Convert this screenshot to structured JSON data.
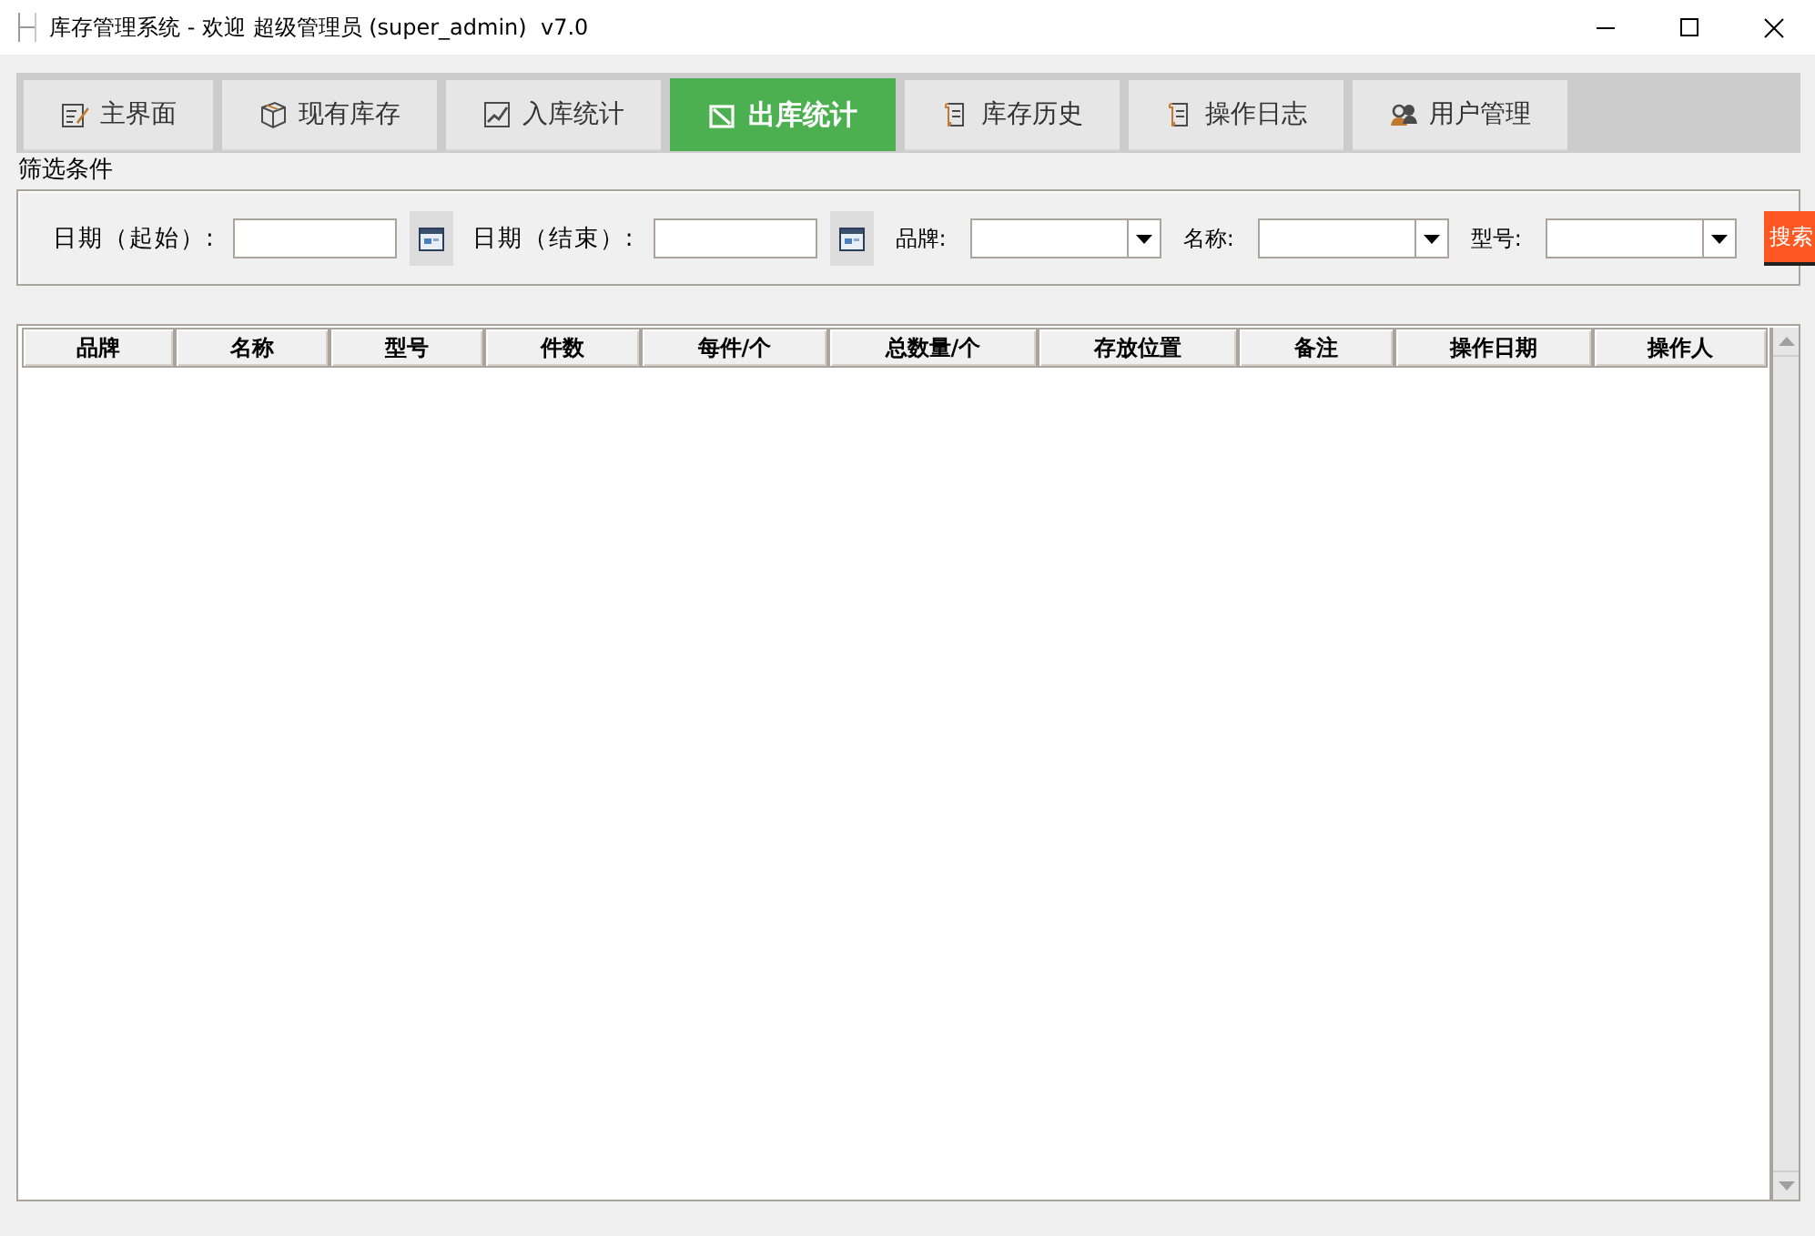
{
  "window": {
    "title": "库存管理系统 - 欢迎 超级管理员 (super_admin)  v7.0"
  },
  "tabs": [
    {
      "label": "主界面",
      "selected": false
    },
    {
      "label": "现有库存",
      "selected": false
    },
    {
      "label": "入库统计",
      "selected": false
    },
    {
      "label": "出库统计",
      "selected": true
    },
    {
      "label": "库存历史",
      "selected": false
    },
    {
      "label": "操作日志",
      "selected": false
    },
    {
      "label": "用户管理",
      "selected": false
    }
  ],
  "filter": {
    "title": "筛选条件",
    "fields": [
      {
        "kind": "date",
        "label": "日期（起始）:"
      },
      {
        "kind": "date",
        "label": "日期（结束）:"
      },
      {
        "kind": "combo",
        "label": "品牌:"
      },
      {
        "kind": "combo",
        "label": "名称:"
      },
      {
        "kind": "combo",
        "label": "型号:"
      }
    ],
    "search_button": "搜索"
  },
  "table": {
    "columns": [
      "品牌",
      "名称",
      "型号",
      "件数",
      "每件/个",
      "总数量/个",
      "存放位置",
      "备注",
      "操作日期",
      "操作人"
    ]
  }
}
